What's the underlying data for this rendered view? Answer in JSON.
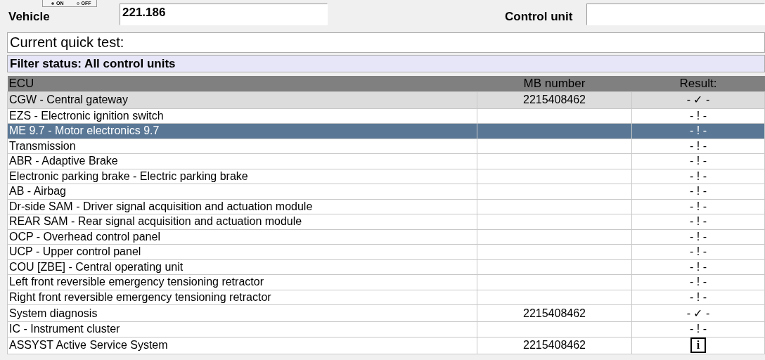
{
  "toggle": {
    "options": [
      {
        "label": "ON",
        "selected": true
      },
      {
        "label": "OFF",
        "selected": false
      }
    ]
  },
  "vehicle": {
    "label": "Vehicle",
    "value": "221.186"
  },
  "control_unit": {
    "label": "Control unit"
  },
  "quick_test": {
    "label": "Current quick test:"
  },
  "filter_status": "Filter status: All control units",
  "table": {
    "columns": [
      "ECU",
      "MB number",
      "Result:"
    ],
    "rows": [
      {
        "ecu": "CGW - Central gateway",
        "mb_number": "2215408462",
        "result": "- ✓ -",
        "focused": true,
        "selected": false
      },
      {
        "ecu": "EZS - Electronic ignition switch",
        "result": "- ! -",
        "focused": false,
        "selected": false
      },
      {
        "ecu": "ME 9.7 - Motor electronics 9.7",
        "result": "- ! -",
        "focused": false,
        "selected": true
      },
      {
        "ecu": "Transmission",
        "result": "- ! -",
        "focused": false,
        "selected": false
      },
      {
        "ecu": "ABR - Adaptive Brake",
        "result": "- ! -",
        "focused": false,
        "selected": false
      },
      {
        "ecu": "Electronic parking brake - Electric parking brake",
        "result": "- ! -",
        "focused": false,
        "selected": false
      },
      {
        "ecu": "AB - Airbag",
        "result": "- ! -",
        "focused": false,
        "selected": false
      },
      {
        "ecu": "Dr-side SAM - Driver signal acquisition and actuation module",
        "result": "- ! -",
        "focused": false,
        "selected": false
      },
      {
        "ecu": "REAR SAM - Rear signal acquisition and actuation module",
        "result": "- ! -",
        "focused": false,
        "selected": false
      },
      {
        "ecu": "OCP - Overhead control panel",
        "result": "- ! -",
        "focused": false,
        "selected": false
      },
      {
        "ecu": "UCP - Upper control panel",
        "result": "- ! -",
        "focused": false,
        "selected": false
      },
      {
        "ecu": "COU [ZBE] - Central operating unit",
        "result": "- ! -",
        "focused": false,
        "selected": false
      },
      {
        "ecu": "Left front reversible emergency tensioning retractor",
        "result": "- ! -",
        "focused": false,
        "selected": false
      },
      {
        "ecu": "Right front reversible emergency tensioning retractor",
        "result": "- ! -",
        "focused": false,
        "selected": false
      },
      {
        "ecu": "System diagnosis",
        "mb_number": "2215408462",
        "result": "- ✓ -",
        "focused": false,
        "selected": false
      },
      {
        "ecu": "IC - Instrument cluster",
        "result": "- ! -",
        "focused": false,
        "selected": false
      },
      {
        "ecu": "ASSYST Active Service System",
        "mb_number": "2215408462",
        "kind": "info",
        "result": "i",
        "focused": false,
        "selected": false
      }
    ]
  }
}
